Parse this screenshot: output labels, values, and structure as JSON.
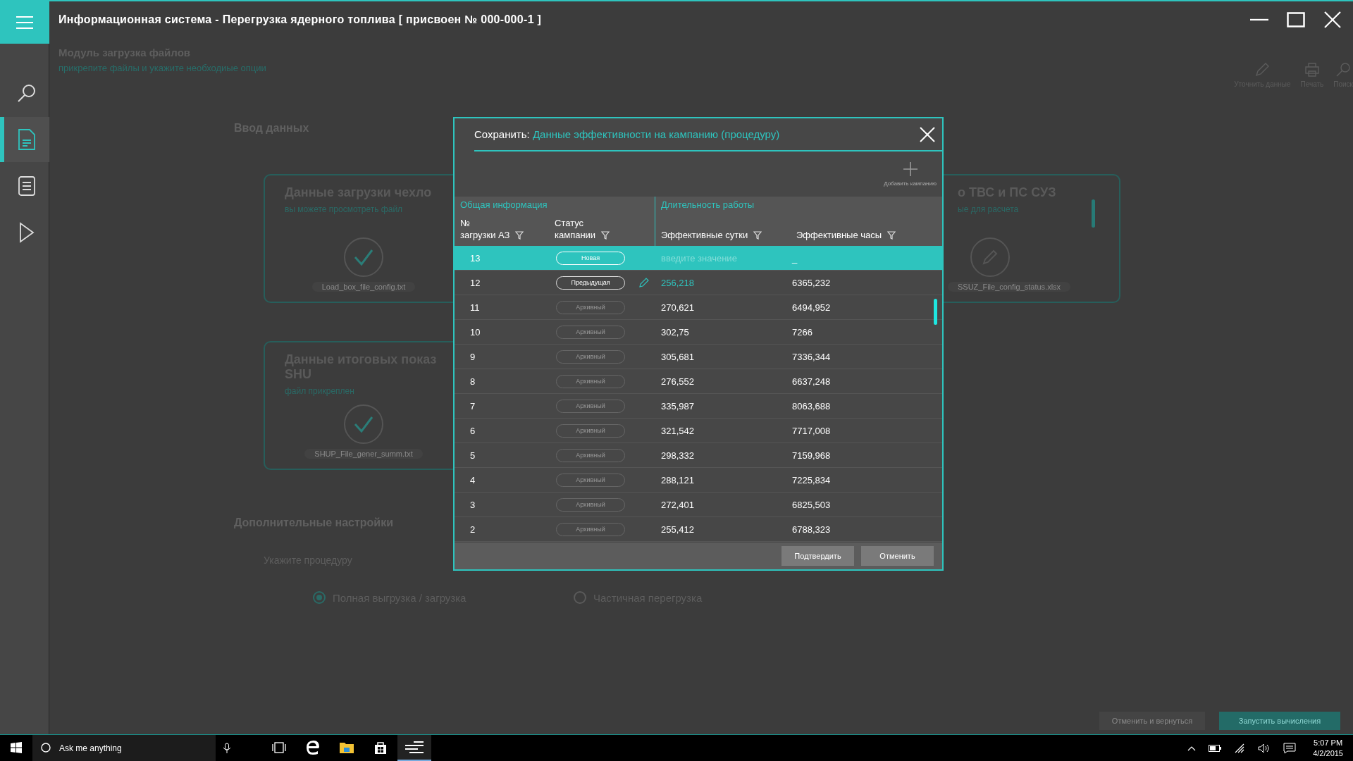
{
  "window": {
    "title": "Информационная система - Перегрузка ядерного топлива [ присвоен № 000-000-1 ]"
  },
  "sidebar": {
    "items": [
      {
        "kind": "search",
        "selected": false
      },
      {
        "kind": "document",
        "selected": true
      },
      {
        "kind": "list",
        "selected": false
      },
      {
        "kind": "play",
        "selected": false
      }
    ]
  },
  "header": {
    "title": "Модуль загрузка файлов",
    "subtitle": "прикрепите файлы и укажите необходиые опции"
  },
  "toolbar": [
    {
      "kind": "edit",
      "label": "Уточнить данные"
    },
    {
      "kind": "print",
      "label": "Печать"
    },
    {
      "kind": "search",
      "label": "Поиск"
    }
  ],
  "section_title": "Ввод данных",
  "cards": [
    {
      "kind": "done",
      "title": [
        "Данные загрузки чехло"
      ],
      "subtitle": "вы можете просмотреть файл",
      "file": "Load_box_file_config.txt"
    },
    {
      "kind": "edit",
      "title": [
        "о ТВС и ПС СУЗ"
      ],
      "subtitle": "ые для расчета",
      "file": "SSUZ_File_config_status.xlsx"
    },
    {
      "kind": "done",
      "title": [
        "Данные итоговых показ",
        "SHU"
      ],
      "subtitle": "файл прикреплен",
      "file": "SHUP_File_gener_summ.txt"
    }
  ],
  "settings": {
    "title": "Дополнительные настройки",
    "label": "Укажите процедуру",
    "options": [
      {
        "label": "Полная выгрузка / загрузка",
        "selected": true
      },
      {
        "label": "Частичная  перегрузка",
        "selected": false
      }
    ]
  },
  "actions": [
    "Отменить и вернуться",
    "Запустить вычисления"
  ],
  "dialog": {
    "prefix": "Сохранить:",
    "title": "Данные эффективности на кампанию (процедуру)",
    "add_label": "Добавить кампанию",
    "groups": [
      "Общая информация",
      "Длительность работы"
    ],
    "columns": [
      [
        "№",
        "загрузки АЗ"
      ],
      [
        "Статус",
        "кампании"
      ],
      [
        "Эффективные сутки"
      ],
      [
        "Эффективные часы"
      ]
    ],
    "rows": [
      {
        "number": "13",
        "kind": "new",
        "status": "Новая",
        "placeholder": "введите значение",
        "hours": "_",
        "selected": true,
        "editing": false
      },
      {
        "number": "12",
        "kind": "previous",
        "status": "Предыдущая",
        "days": "256,218",
        "hours": "6365,232",
        "selected": false,
        "editing": true
      },
      {
        "number": "11",
        "kind": "archive",
        "status": "Архивный",
        "days": "270,621",
        "hours": "6494,952",
        "selected": false,
        "editing": false
      },
      {
        "number": "10",
        "kind": "archive",
        "status": "Архивный",
        "days": "302,75",
        "hours": "7266",
        "selected": false,
        "editing": false
      },
      {
        "number": "9",
        "kind": "archive",
        "status": "Архивный",
        "days": "305,681",
        "hours": "7336,344",
        "selected": false,
        "editing": false
      },
      {
        "number": "8",
        "kind": "archive",
        "status": "Архивный",
        "days": "276,552",
        "hours": "6637,248",
        "selected": false,
        "editing": false
      },
      {
        "number": "7",
        "kind": "archive",
        "status": "Архивный",
        "days": "335,987",
        "hours": "8063,688",
        "selected": false,
        "editing": false
      },
      {
        "number": "6",
        "kind": "archive",
        "status": "Архивный",
        "days": "321,542",
        "hours": "7717,008",
        "selected": false,
        "editing": false
      },
      {
        "number": "5",
        "kind": "archive",
        "status": "Архивный",
        "days": "298,332",
        "hours": "7159,968",
        "selected": false,
        "editing": false
      },
      {
        "number": "4",
        "kind": "archive",
        "status": "Архивный",
        "days": "288,121",
        "hours": "7225,834",
        "selected": false,
        "editing": false
      },
      {
        "number": "3",
        "kind": "archive",
        "status": "Архивный",
        "days": "272,401",
        "hours": "6825,503",
        "selected": false,
        "editing": false
      },
      {
        "number": "2",
        "kind": "archive",
        "status": "Архивный",
        "days": "255,412",
        "hours": "6788,323",
        "selected": false,
        "editing": false
      }
    ],
    "buttons": [
      "Подтвердить",
      "Отменить"
    ]
  },
  "taskbar": {
    "search_placeholder": "Ask me anything",
    "apps": [
      {
        "kind": "taskview",
        "active": false
      },
      {
        "kind": "browser",
        "active": false
      },
      {
        "kind": "folder",
        "active": false
      },
      {
        "kind": "store",
        "active": false
      },
      {
        "kind": "app",
        "active": true
      }
    ],
    "time": "5:07 PM",
    "date": "4/2/2015"
  }
}
